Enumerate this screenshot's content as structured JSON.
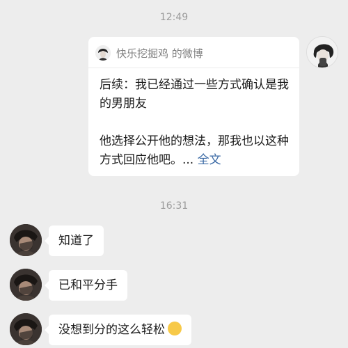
{
  "chat": {
    "timestamps": [
      "12:49",
      "16:31"
    ],
    "share_card": {
      "source": "快乐挖掘鸡 的微博",
      "line1": "后续：我已经通过一些方式确认是我的男朋友",
      "line2": "他选择公开他的想法，那我也以这种方式回应他吧。... ",
      "more": "全文"
    },
    "messages": [
      {
        "text": "知道了"
      },
      {
        "text": "已和平分手"
      },
      {
        "text": "没想到分的这么轻松"
      }
    ]
  }
}
